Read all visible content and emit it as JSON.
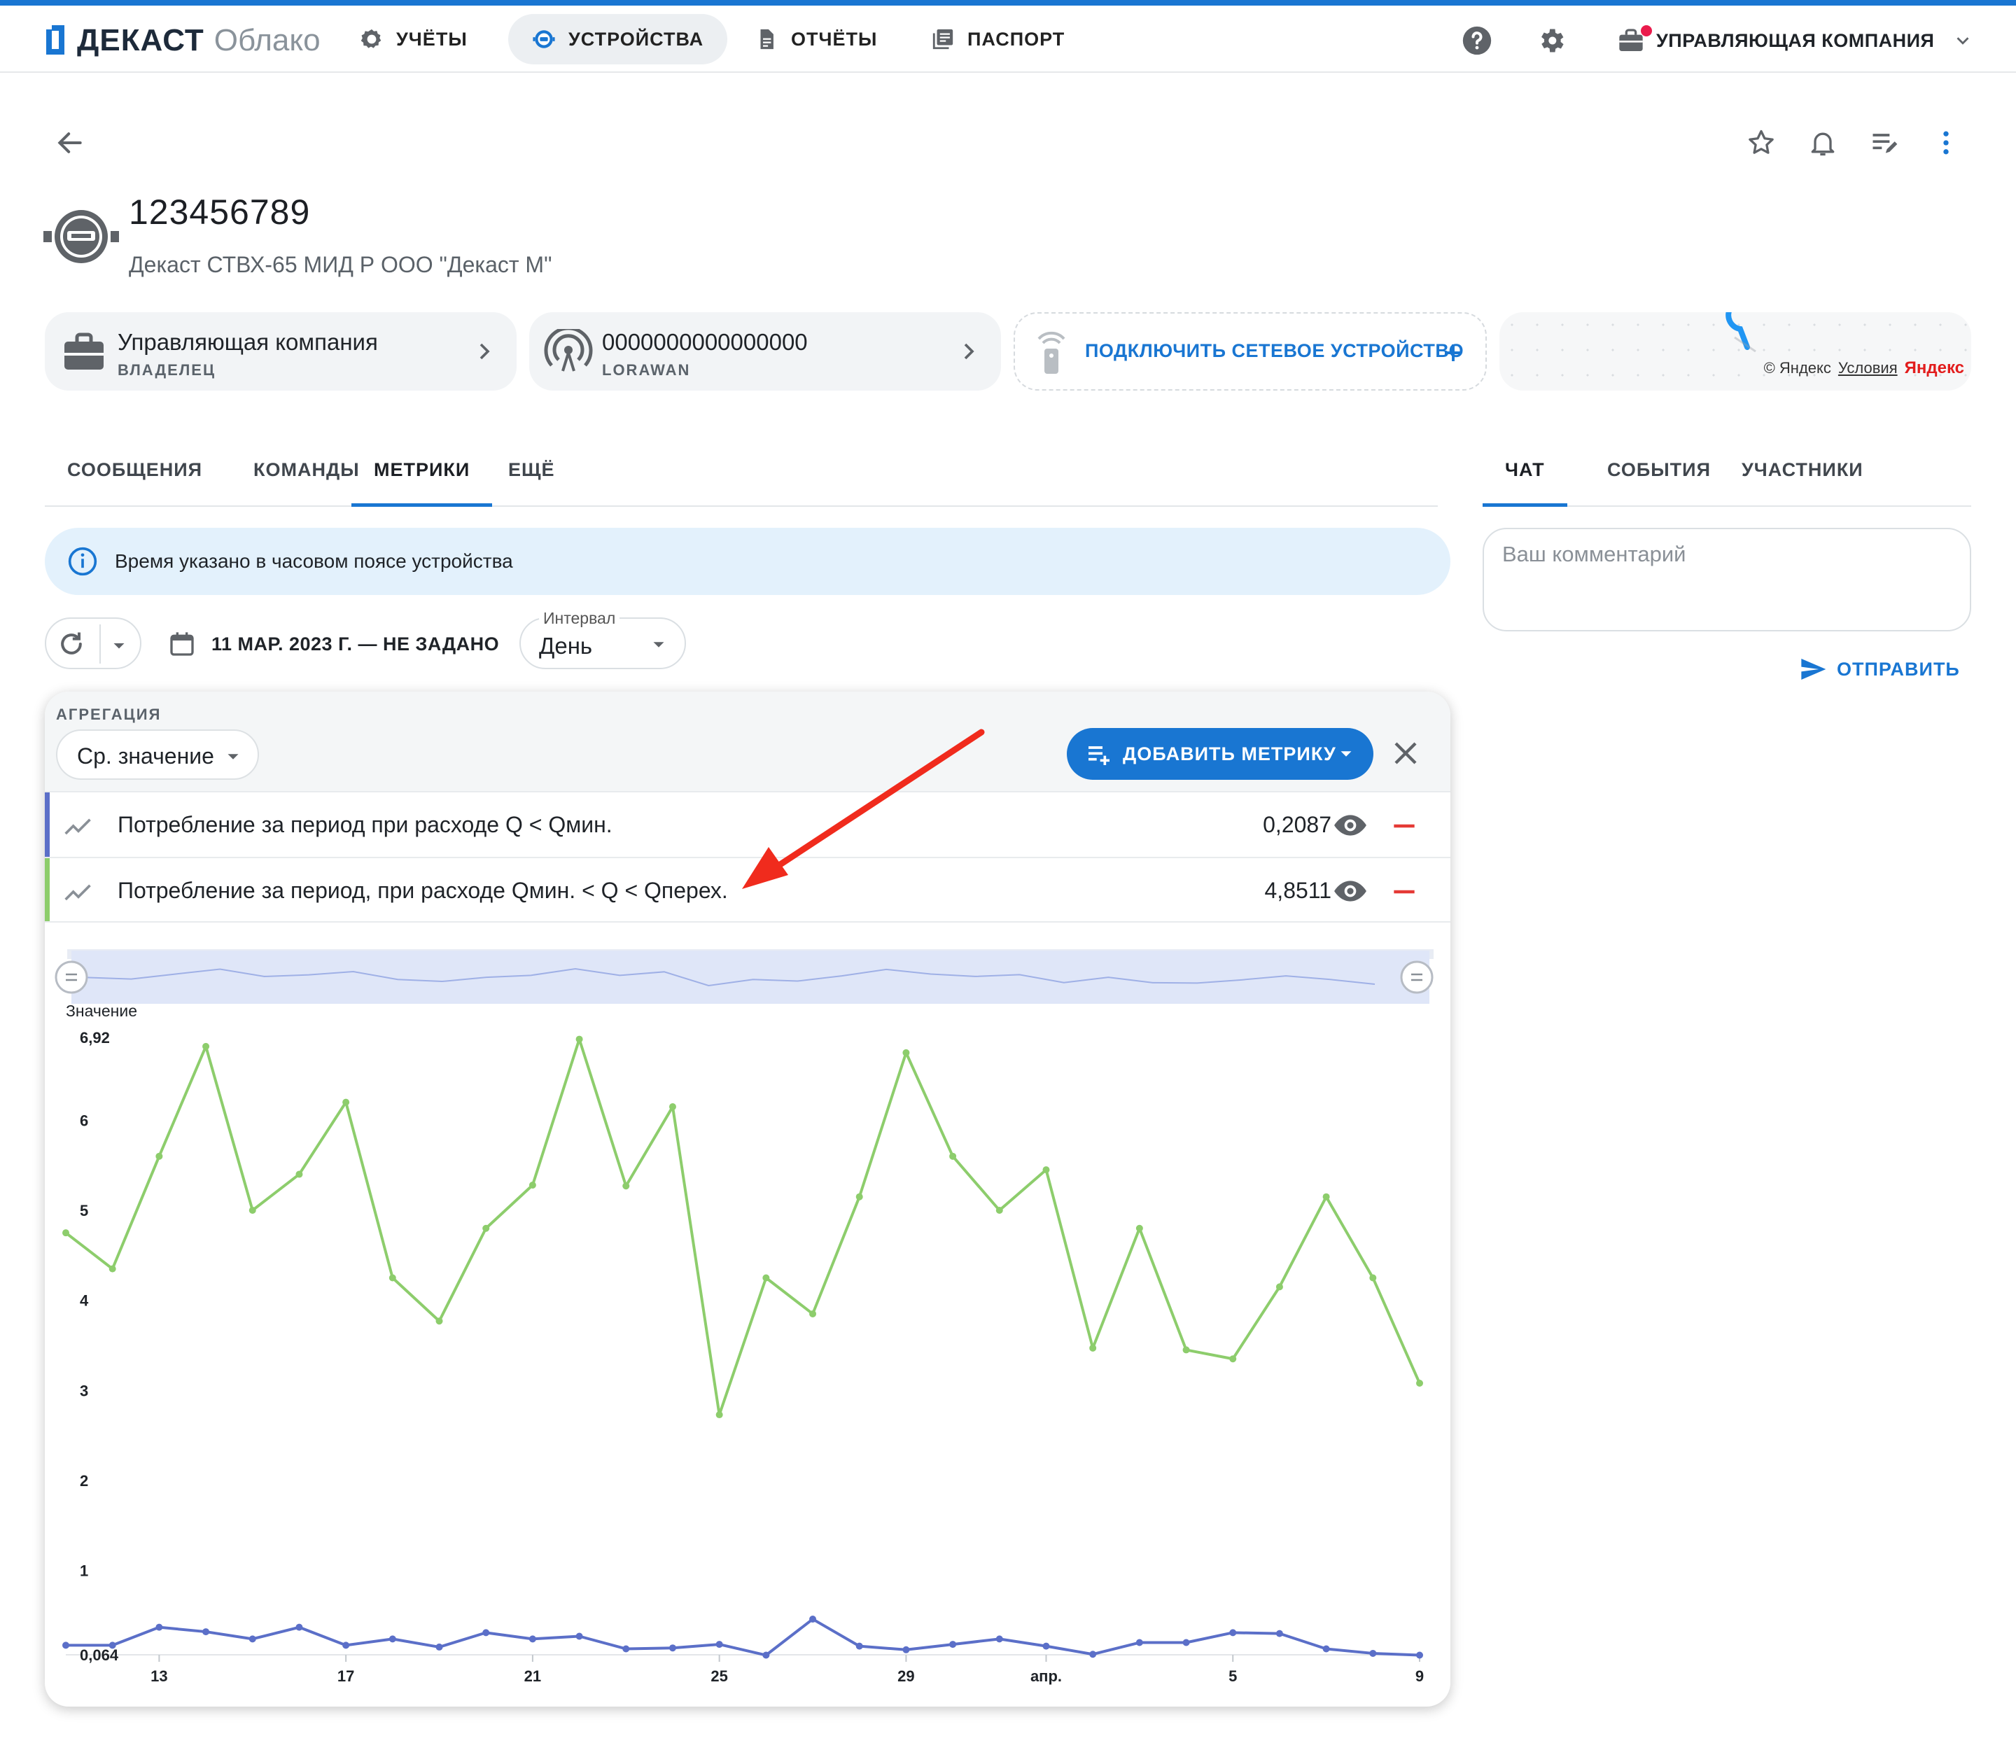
{
  "app": {
    "brand": "ДЕКАСТ",
    "product": "Облако"
  },
  "nav": {
    "items": [
      {
        "label": "УЧЁТЫ",
        "active": false
      },
      {
        "label": "УСТРОЙСТВА",
        "active": true
      },
      {
        "label": "ОТЧЁТЫ",
        "active": false
      },
      {
        "label": "ПАСПОРТ",
        "active": false
      }
    ],
    "company": "УПРАВЛЯЮЩАЯ КОМПАНИЯ"
  },
  "device": {
    "title": "123456789",
    "subtitle": "Декаст СТВХ-65 МИД Р ООО \"Декаст М\""
  },
  "cards": {
    "owner": {
      "title": "Управляющая компания",
      "subtitle": "ВЛАДЕЛЕЦ"
    },
    "network": {
      "title": "0000000000000000",
      "subtitle": "LORAWAN"
    },
    "connect": {
      "label": "ПОДКЛЮЧИТЬ СЕТЕВОЕ УСТРОЙСТВО"
    },
    "map": {
      "copyright": "© Яндекс",
      "terms": "Условия",
      "provider": "Яндекс"
    }
  },
  "tabs": {
    "left": [
      {
        "label": "СООБЩЕНИЯ",
        "active": false
      },
      {
        "label": "КОМАНДЫ",
        "active": false
      },
      {
        "label": "МЕТРИКИ",
        "active": true
      },
      {
        "label": "ЕЩЁ",
        "active": false
      }
    ],
    "right": [
      {
        "label": "ЧАТ",
        "active": true
      },
      {
        "label": "СОБЫТИЯ",
        "active": false
      },
      {
        "label": "УЧАСТНИКИ",
        "active": false
      }
    ]
  },
  "info": {
    "text": "Время указано в часовом поясе устройства"
  },
  "filters": {
    "date_range": "11 МАР. 2023 Г. — НЕ ЗАДАНО",
    "interval_label": "Интервал",
    "interval_value": "День"
  },
  "metrics_panel": {
    "aggregation_label": "АГРЕГАЦИЯ",
    "aggregation_value": "Ср. значение",
    "add_metric_label": "ДОБАВИТЬ МЕТРИКУ",
    "rows": [
      {
        "name": "Потребление за период при расходе Q < Qмин.",
        "value": "0,2087",
        "color": "#5b6fc8"
      },
      {
        "name": "Потребление за период, при расходе Qмин. < Q < Qперех.",
        "value": "4,8511",
        "color": "#8dcd6c"
      }
    ]
  },
  "chat": {
    "placeholder": "Ваш комментарий",
    "send_label": "ОТПРАВИТЬ"
  },
  "colors": {
    "accent": "#1976d2",
    "series_green": "#8dcd6c",
    "series_blue": "#5b6fc8",
    "annotation_arrow": "#f02b1d"
  },
  "chart_data": {
    "type": "line",
    "ylabel": "Значение",
    "ylim": [
      0.064,
      6.92
    ],
    "y_ticks": [
      "6,92",
      "6",
      "5",
      "4",
      "3",
      "2",
      "1",
      "0,064"
    ],
    "x_tick_labels": [
      {
        "label": "13",
        "index": 2
      },
      {
        "label": "17",
        "index": 6
      },
      {
        "label": "21",
        "index": 10
      },
      {
        "label": "25",
        "index": 14
      },
      {
        "label": "29",
        "index": 18
      },
      {
        "label": "апр.",
        "index": 21
      },
      {
        "label": "5",
        "index": 25
      },
      {
        "label": "9",
        "index": 29
      }
    ],
    "series": [
      {
        "name": "Потребление за период, при расходе Qмин. < Q < Qперех.",
        "color": "#8dcd6c",
        "values": [
          4.75,
          4.35,
          5.6,
          6.82,
          5.0,
          5.4,
          6.2,
          4.25,
          3.77,
          4.8,
          5.28,
          6.9,
          5.27,
          6.15,
          2.73,
          4.25,
          3.85,
          5.15,
          6.75,
          5.6,
          5.0,
          5.45,
          3.47,
          4.8,
          3.45,
          3.35,
          4.15,
          5.15,
          4.25,
          3.08
        ]
      },
      {
        "name": "Потребление за период при расходе Q < Qмин.",
        "color": "#5b6fc8",
        "values": [
          0.17,
          0.17,
          0.37,
          0.32,
          0.24,
          0.37,
          0.17,
          0.24,
          0.15,
          0.31,
          0.24,
          0.27,
          0.13,
          0.14,
          0.18,
          0.06,
          0.46,
          0.16,
          0.12,
          0.18,
          0.24,
          0.16,
          0.07,
          0.2,
          0.2,
          0.31,
          0.3,
          0.13,
          0.08,
          0.06
        ]
      }
    ]
  }
}
